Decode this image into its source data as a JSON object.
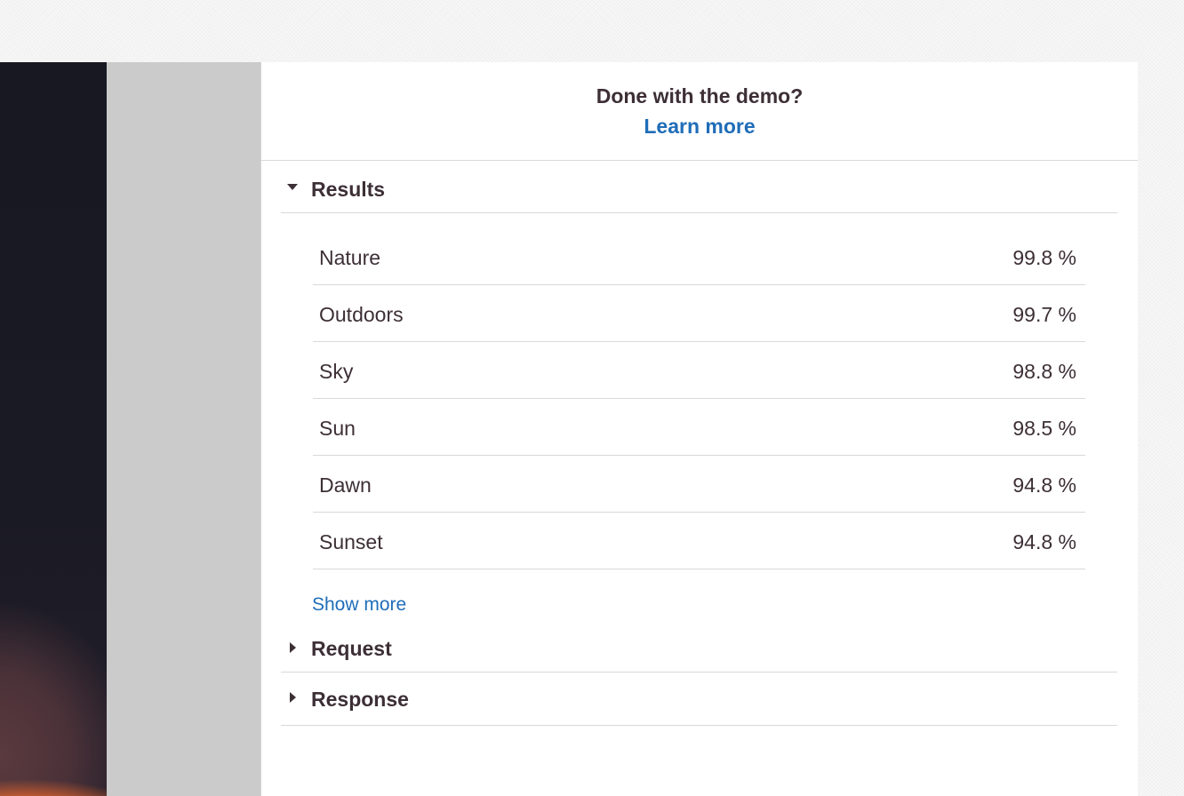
{
  "banner": {
    "title": "Done with the demo?",
    "link_label": "Learn more"
  },
  "results": {
    "header": "Results",
    "expanded": true,
    "items": [
      {
        "label": "Nature",
        "confidence": "99.8 %"
      },
      {
        "label": "Outdoors",
        "confidence": "99.7 %"
      },
      {
        "label": "Sky",
        "confidence": "98.8 %"
      },
      {
        "label": "Sun",
        "confidence": "98.5 %"
      },
      {
        "label": "Dawn",
        "confidence": "94.8 %"
      },
      {
        "label": "Sunset",
        "confidence": "94.8 %"
      }
    ],
    "show_more_label": "Show more"
  },
  "request": {
    "header": "Request",
    "expanded": false
  },
  "response": {
    "header": "Response",
    "expanded": false
  },
  "colors": {
    "text": "#3d2f36",
    "link": "#1f6db8",
    "divider": "#d9d9d9",
    "side_gray": "#cbcbcb"
  }
}
